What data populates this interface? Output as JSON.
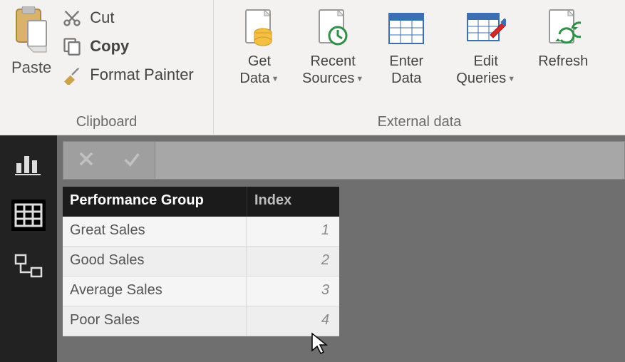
{
  "ribbon": {
    "clipboard": {
      "group_label": "Clipboard",
      "paste": "Paste",
      "cut": "Cut",
      "copy": "Copy",
      "format_painter": "Format Painter"
    },
    "external": {
      "group_label": "External data",
      "get_data": "Get\nData",
      "recent_sources": "Recent\nSources",
      "enter_data": "Enter\nData",
      "edit_queries": "Edit\nQueries",
      "refresh": "Refresh",
      "caret": "▼"
    }
  },
  "table": {
    "headers": {
      "col1": "Performance Group",
      "col2": "Index"
    },
    "rows": [
      {
        "label": "Great Sales",
        "index": "1"
      },
      {
        "label": "Good Sales",
        "index": "2"
      },
      {
        "label": "Average Sales",
        "index": "3"
      },
      {
        "label": "Poor Sales",
        "index": "4"
      }
    ]
  }
}
